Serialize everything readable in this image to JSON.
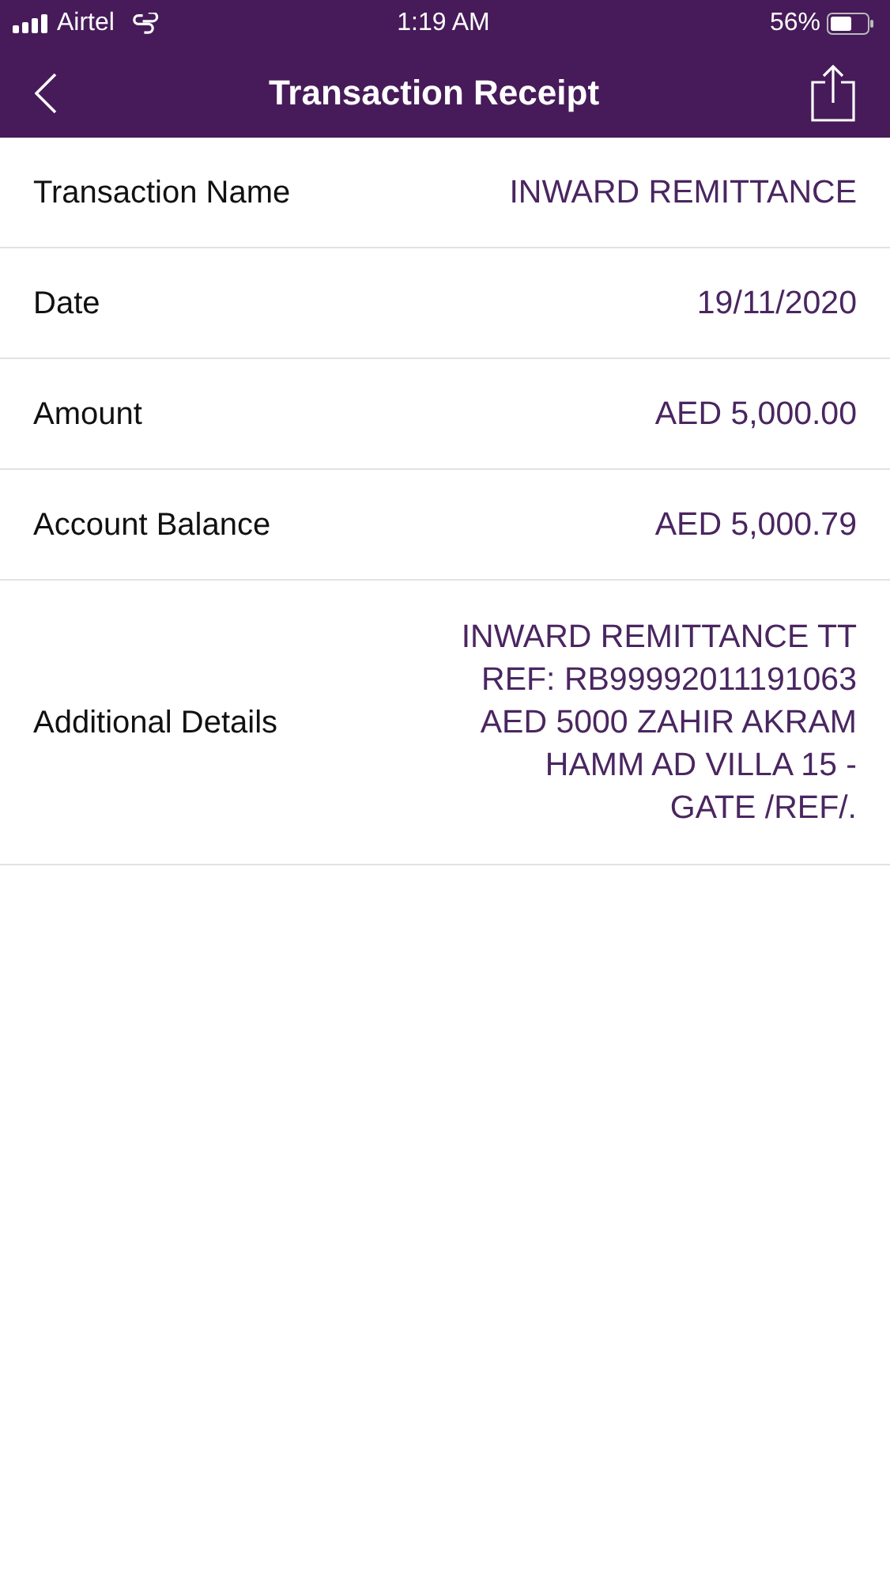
{
  "status_bar": {
    "carrier": "Airtel",
    "time": "1:19 AM",
    "battery": "56%"
  },
  "header": {
    "title": "Transaction Receipt"
  },
  "rows": [
    {
      "label": "Transaction Name",
      "value_lines": [
        "INWARD REMITTANCE"
      ]
    },
    {
      "label": "Date",
      "value_lines": [
        "19/11/2020"
      ]
    },
    {
      "label": "Amount",
      "value_lines": [
        "AED 5,000.00"
      ]
    },
    {
      "label": "Account Balance",
      "value_lines": [
        "AED 5,000.79"
      ]
    },
    {
      "label": "Additional Details",
      "value_lines": [
        "INWARD REMITTANCE TT",
        "REF: RB99992011191063",
        "AED 5000 ZAHIR AKRAM",
        "HAMM AD VILLA 15 -",
        "GATE /REF/."
      ]
    }
  ]
}
